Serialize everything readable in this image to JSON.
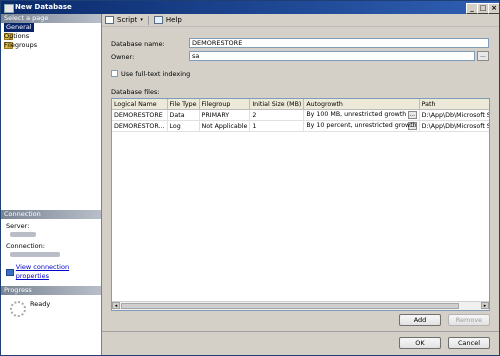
{
  "window": {
    "title": "New Database",
    "controls": [
      "_",
      "□",
      "×"
    ]
  },
  "sidebar": {
    "section_header": "Select a page",
    "items": [
      {
        "label": "General",
        "selected": true
      },
      {
        "label": "Options",
        "selected": false
      },
      {
        "label": "Filegroups",
        "selected": false
      }
    ],
    "connection": {
      "header": "Connection",
      "server_label": "Server:",
      "connection_label": "Connection:",
      "view_link": "View connection properties"
    },
    "progress": {
      "header": "Progress",
      "status": "Ready"
    }
  },
  "toolbar": {
    "script_label": "Script",
    "help_label": "Help"
  },
  "form": {
    "database_name_label": "Database name:",
    "database_name_value": "DEMORESTORE",
    "owner_label": "Owner:",
    "owner_value": "sa",
    "owner_browse": "...",
    "fulltext_label": "Use full-text indexing",
    "fulltext_checked": false,
    "database_files_label": "Database files:"
  },
  "files_table": {
    "columns": [
      "Logical Name",
      "File Type",
      "Filegroup",
      "Initial Size (MB)",
      "Autogrowth",
      "Path"
    ],
    "rows": [
      {
        "logical_name": "DEMORESTORE",
        "file_type": "Data",
        "filegroup": "PRIMARY",
        "initial_size": "2",
        "autogrowth": "By 100 MB, unrestricted growth",
        "path": "D:\\App\\Db\\Microsoft SQ"
      },
      {
        "logical_name": "DEMORESTOR...",
        "file_type": "Log",
        "filegroup": "Not Applicable",
        "initial_size": "1",
        "autogrowth": "By 10 percent, unrestricted growth",
        "path": "D:\\App\\Db\\Microsoft SQ"
      }
    ],
    "cell_button": "..."
  },
  "buttons": {
    "add": "Add",
    "remove": "Remove",
    "ok": "OK",
    "cancel": "Cancel"
  }
}
